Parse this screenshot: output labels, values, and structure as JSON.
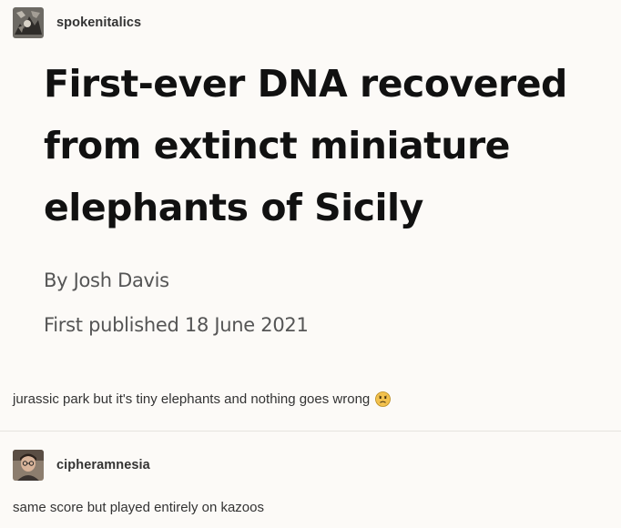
{
  "post1": {
    "username": "spokenitalics",
    "article": {
      "headline": "First-ever DNA recovered from extinct miniature elephants of Sicily",
      "byline": "By Josh Davis",
      "published": "First published 18 June 2021"
    },
    "comment": "jurassic park but it's tiny elephants and nothing goes wrong"
  },
  "post2": {
    "username": "cipheramnesia",
    "comment": "same score but played entirely on kazoos"
  },
  "icons": {
    "emoji": "worried-face-emoji"
  },
  "colors": {
    "background": "#fcfaf7",
    "emoji_yellow": "#f2c14e"
  }
}
